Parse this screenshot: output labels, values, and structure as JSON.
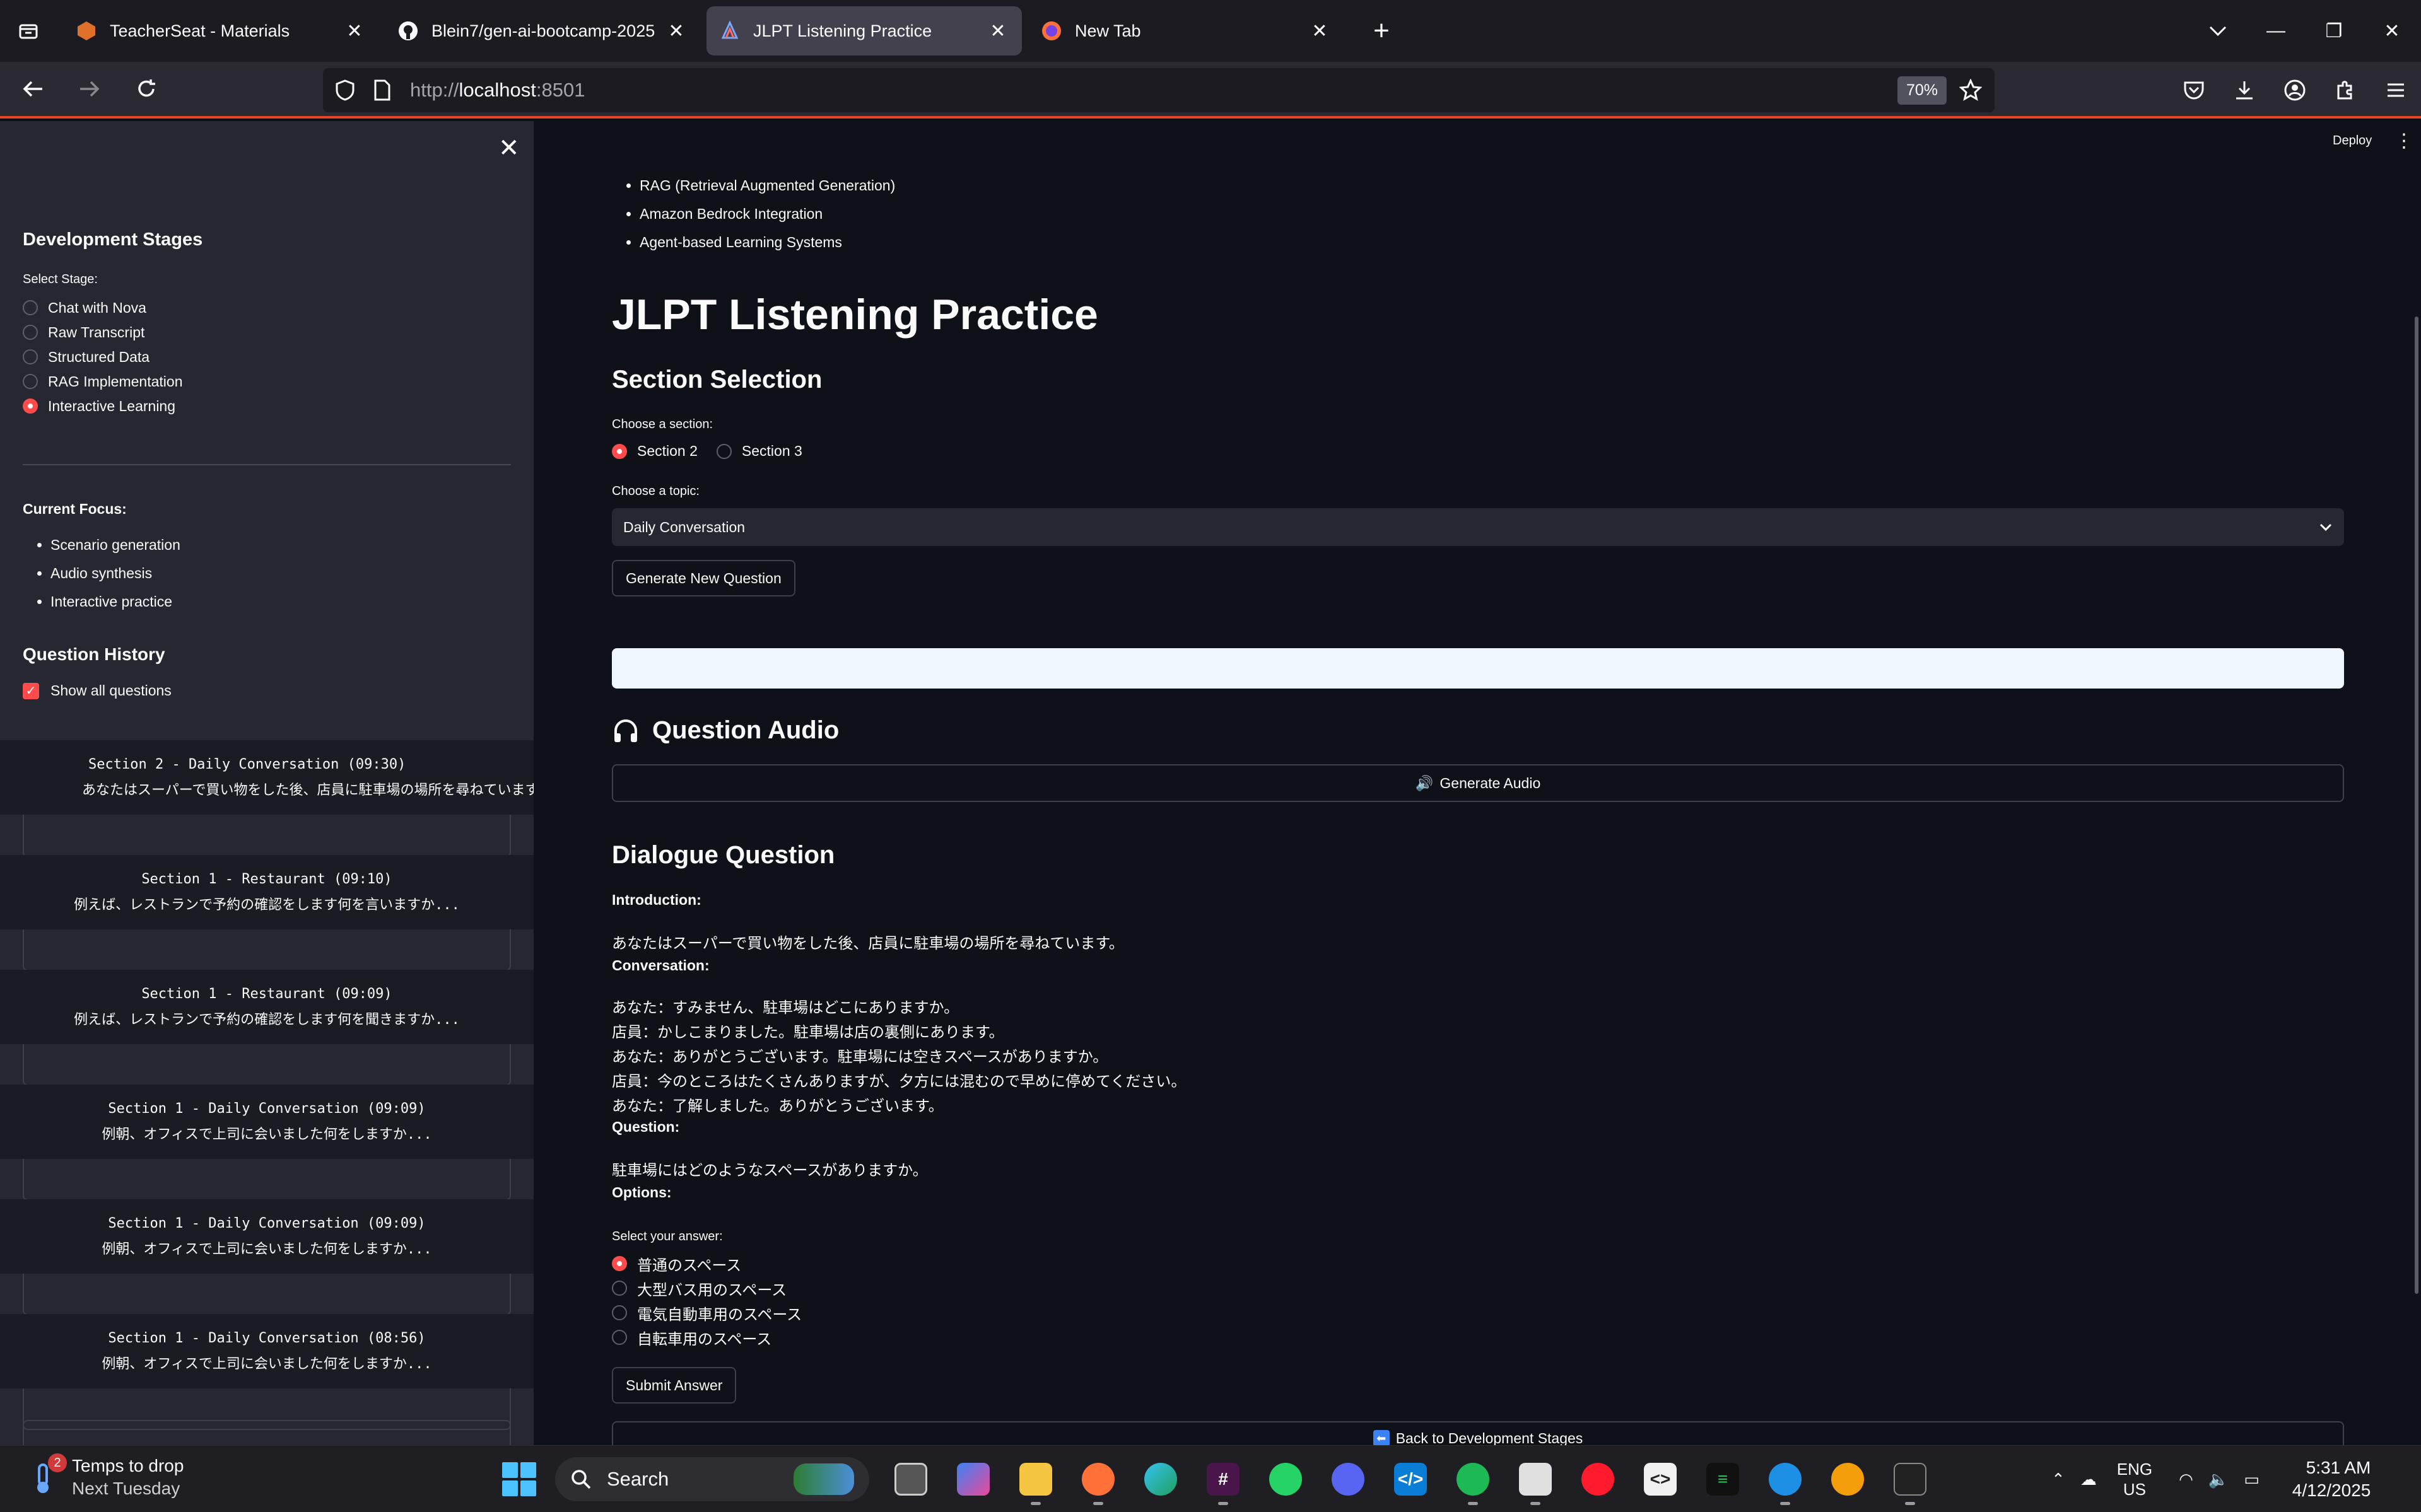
{
  "browser": {
    "tabs": [
      {
        "label": "TeacherSeat - Materials",
        "active": false,
        "favicon": "hexagon-icon"
      },
      {
        "label": "Blein7/gen-ai-bootcamp-2025",
        "active": false,
        "favicon": "github-icon"
      },
      {
        "label": "JLPT Listening Practice",
        "active": true,
        "favicon": "streamlit-icon"
      },
      {
        "label": "New Tab",
        "active": false,
        "favicon": "firefox-icon"
      }
    ],
    "url_prefix": "http://",
    "url_host": "localhost",
    "url_port": ":8501",
    "zoom": "70%"
  },
  "sidebar": {
    "title": "Development Stages",
    "select_label": "Select Stage:",
    "stages": [
      {
        "label": "Chat with Nova",
        "selected": false
      },
      {
        "label": "Raw Transcript",
        "selected": false
      },
      {
        "label": "Structured Data",
        "selected": false
      },
      {
        "label": "RAG Implementation",
        "selected": false
      },
      {
        "label": "Interactive Learning",
        "selected": true
      }
    ],
    "focus_title": "Current Focus:",
    "focus_items": [
      "Scenario generation",
      "Audio synthesis",
      "Interactive practice"
    ],
    "history_title": "Question History",
    "show_all_label": "Show all questions",
    "history": [
      {
        "title": "Section 2 - Daily Conversation (09:30)",
        "snippet": "あなたはスーパーで買い物をした後、店員に駐車場の場所を尋ねています"
      },
      {
        "title": "Section 1 - Restaurant (09:10)",
        "snippet": "例えば、レストランで予約の確認をします何を言いますか..."
      },
      {
        "title": "Section 1 - Restaurant (09:09)",
        "snippet": "例えば、レストランで予約の確認をします何を聞きますか..."
      },
      {
        "title": "Section 1 - Daily Conversation (09:09)",
        "snippet": "例朝、オフィスで上司に会いました何をしますか..."
      },
      {
        "title": "Section 1 - Daily Conversation (09:09)",
        "snippet": "例朝、オフィスで上司に会いました何をしますか..."
      },
      {
        "title": "Section 1 - Daily Conversation (08:56)",
        "snippet": "例朝、オフィスで上司に会いました何をしますか..."
      }
    ]
  },
  "main": {
    "deploy_label": "Deploy",
    "tech_items": [
      "RAG (Retrieval Augmented Generation)",
      "Amazon Bedrock Integration",
      "Agent-based Learning Systems"
    ],
    "title": "JLPT Listening Practice",
    "section_heading": "Section Selection",
    "section_label": "Choose a section:",
    "sections": [
      {
        "label": "Section 2",
        "selected": true
      },
      {
        "label": "Section 3",
        "selected": false
      }
    ],
    "topic_label": "Choose a topic:",
    "topic_value": "Daily Conversation",
    "generate_question_label": "Generate New Question",
    "progress": 1.0,
    "audio_heading": "Question Audio",
    "generate_audio_label": "Generate Audio",
    "dialogue_heading": "Dialogue Question",
    "introduction_label": "Introduction:",
    "introduction_text": "あなたはスーパーで買い物をした後、店員に駐車場の場所を尋ねています。",
    "conversation_label": "Conversation:",
    "conversation": [
      "あなた：すみません、駐車場はどこにありますか。",
      "店員：かしこまりました。駐車場は店の裏側にあります。",
      "あなた：ありがとうございます。駐車場には空きスペースがありますか。",
      "店員：今のところはたくさんありますが、夕方には混むので早めに停めてください。",
      "あなた：了解しました。ありがとうございます。"
    ],
    "question_label": "Question:",
    "question_text": "駐車場にはどのようなスペースがありますか。",
    "options_label": "Options:",
    "answer_label": "Select your answer:",
    "options": [
      {
        "label": "普通のスペース",
        "selected": true
      },
      {
        "label": "大型バス用のスペース",
        "selected": false
      },
      {
        "label": "電気自動車用のスペース",
        "selected": false
      },
      {
        "label": "自転車用のスペース",
        "selected": false
      }
    ],
    "submit_label": "Submit Answer",
    "back_label": "Back to Development Stages"
  },
  "taskbar": {
    "weather_badge": "2",
    "weather_line1": "Temps to drop",
    "weather_line2": "Next Tuesday",
    "search_placeholder": "Search",
    "lang_line1": "ENG",
    "lang_line2": "US",
    "time": "5:31 AM",
    "date": "4/12/2025"
  },
  "colors": {
    "accent": "#ff4b4b",
    "background": "#0e1117",
    "sidebar": "#262730",
    "firefox_accent": "#e84522"
  }
}
